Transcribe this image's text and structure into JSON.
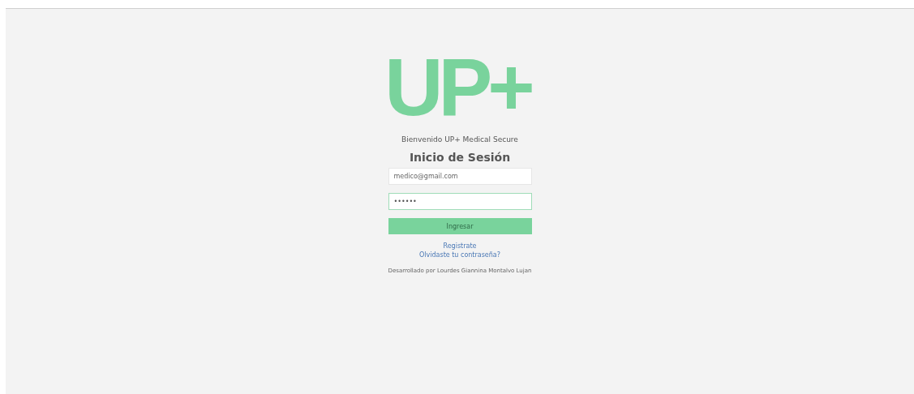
{
  "logo": "UP+",
  "welcome": "Bienvenido UP+ Medical Secure",
  "heading": "Inicio de Sesión",
  "fields": [
    {
      "value": "medico@gmail.com",
      "focused": false
    },
    {
      "value": "••••••",
      "focused": true
    }
  ],
  "submit": "Ingresar",
  "links": [
    "Registrate",
    "Olvidaste tu contraseña?"
  ],
  "footer": "Desarrollado por Lourdes Giannina Montalvo Lujan"
}
